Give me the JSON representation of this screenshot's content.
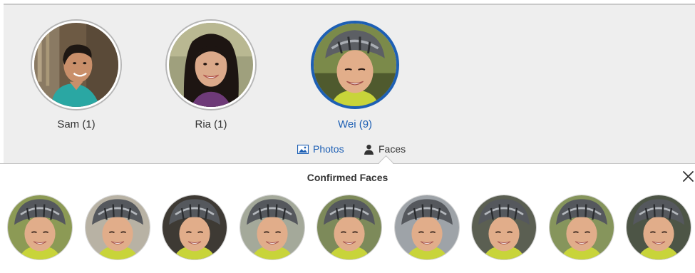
{
  "people": [
    {
      "name": "Sam (1)",
      "selected": false
    },
    {
      "name": "Ria (1)",
      "selected": false
    },
    {
      "name": "Wei (9)",
      "selected": true
    }
  ],
  "view_toggle": {
    "photos_label": "Photos",
    "faces_label": "Faces",
    "active": "faces"
  },
  "confirmed_faces": {
    "title": "Confirmed Faces",
    "count": 9
  },
  "colors": {
    "accent": "#1d5fb4",
    "panel_bg": "#eeeeee",
    "text": "#333333"
  },
  "icons": {
    "photos_tab": "photos-icon",
    "faces_tab": "person-icon",
    "close": "close-icon"
  }
}
